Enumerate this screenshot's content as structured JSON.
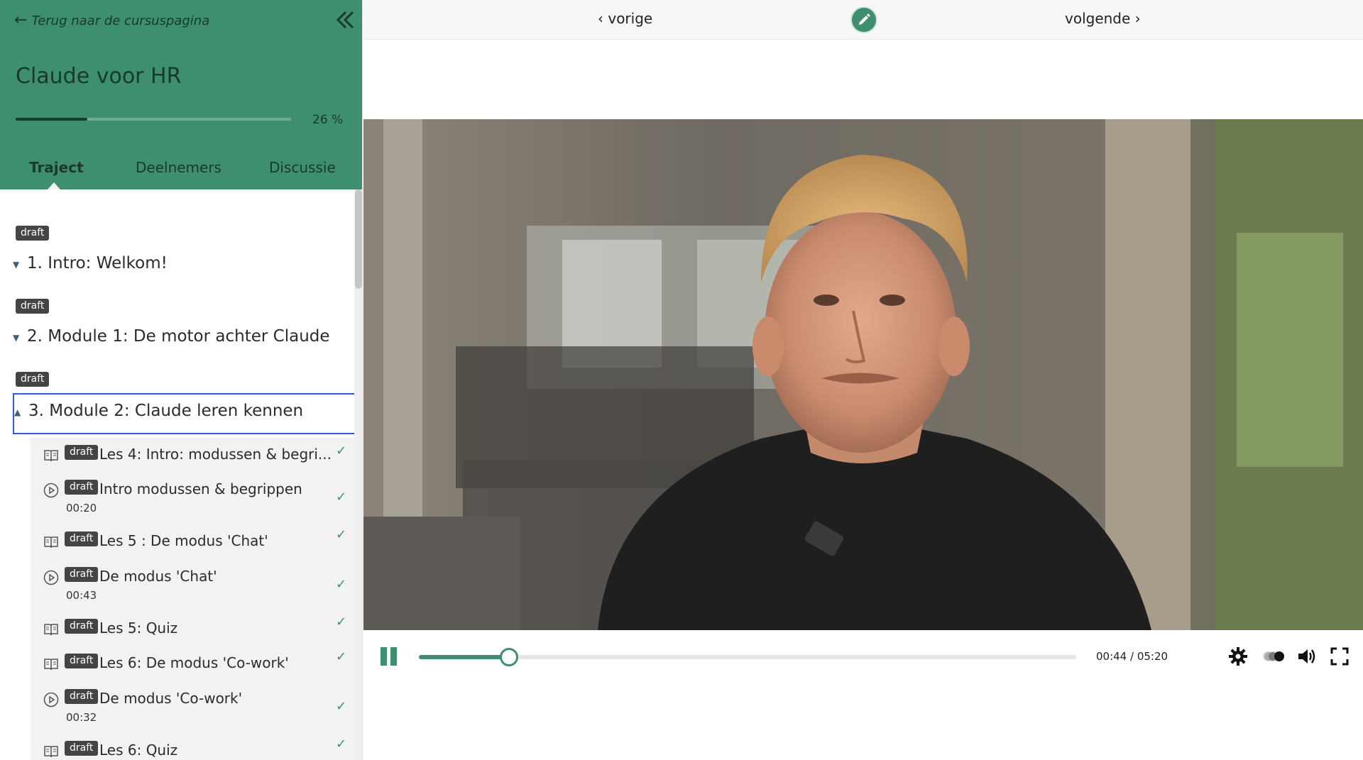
{
  "sidebar": {
    "back_label": "Terug naar de cursuspagina",
    "course_title": "Claude voor HR",
    "progress_percent": 26,
    "progress_label": "26 %",
    "tabs": [
      {
        "label": "Traject",
        "active": true
      },
      {
        "label": "Deelnemers",
        "active": false
      },
      {
        "label": "Discussie",
        "active": false
      }
    ],
    "modules": [
      {
        "badge": "draft",
        "title": "1. Intro: Welkom!",
        "expanded": false
      },
      {
        "badge": "draft",
        "title": "2. Module 1: De motor achter Claude",
        "expanded": false
      },
      {
        "badge": "draft",
        "title": "3. Module 2: Claude leren kennen",
        "expanded": true
      }
    ],
    "lessons": [
      {
        "type": "book-icon",
        "badge": "draft",
        "title": "Les 4: Intro: modussen & begri...",
        "duration": "",
        "done": true
      },
      {
        "type": "play-circle-icon",
        "badge": "draft",
        "title": "Intro modussen & begrippen",
        "duration": "00:20",
        "done": true
      },
      {
        "type": "book-icon",
        "badge": "draft",
        "title": "Les 5 : De modus 'Chat'",
        "duration": "",
        "done": true
      },
      {
        "type": "play-circle-icon",
        "badge": "draft",
        "title": "De modus 'Chat'",
        "duration": "00:43",
        "done": true
      },
      {
        "type": "book-icon",
        "badge": "draft",
        "title": "Les 5: Quiz",
        "duration": "",
        "done": true
      },
      {
        "type": "book-icon",
        "badge": "draft",
        "title": "Les 6: De modus 'Co-work'",
        "duration": "",
        "done": true
      },
      {
        "type": "play-circle-icon",
        "badge": "draft",
        "title": "De modus 'Co-work'",
        "duration": "00:32",
        "done": true
      },
      {
        "type": "book-icon",
        "badge": "draft",
        "title": "Les 6: Quiz",
        "duration": "",
        "done": true
      }
    ]
  },
  "topbar": {
    "prev_label": "‹ vorige",
    "next_label": "volgende ›"
  },
  "player": {
    "time_label": "00:44 / 05:20",
    "played_fraction": 0.1375
  },
  "colors": {
    "brand_green": "#3e8e70",
    "dark_green": "#173a2d",
    "badge_bg": "#444444",
    "selection_blue": "#2f5fd0"
  }
}
